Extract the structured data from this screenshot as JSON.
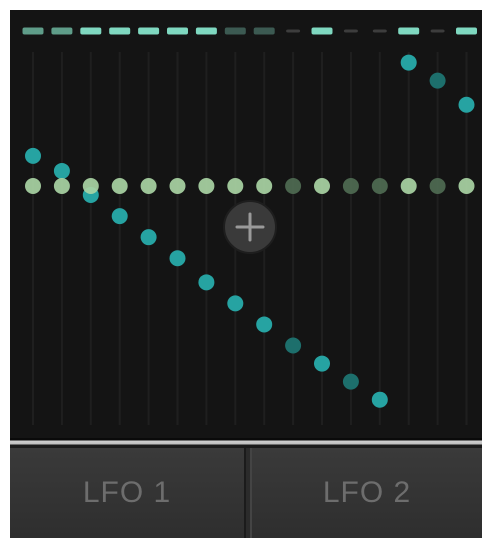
{
  "sequencer": {
    "step_count": 16,
    "colors": {
      "background": "#141414",
      "grid_line": "#1f1f1f",
      "indicator_bright": "#7fd8c0",
      "indicator_mid": "#5f9d89",
      "indicator_dim": "#3c5a52",
      "indicator_off": "#3d3d3d",
      "node_bright": "#a9d4a4",
      "node_dim": "#4f6b52",
      "node_teal": "#26a3a2",
      "node_teal_dim": "#1d6f6c"
    },
    "step_indicators": [
      "mid",
      "mid",
      "bright",
      "bright",
      "bright",
      "bright",
      "bright",
      "dim",
      "dim",
      "off",
      "bright",
      "off",
      "off",
      "bright",
      "off",
      "bright"
    ],
    "lanes": [
      {
        "name": "flat",
        "values": [
          0.5,
          0.5,
          0.5,
          0.5,
          0.5,
          0.5,
          0.5,
          0.5,
          0.5,
          0.5,
          0.5,
          0.5,
          0.5,
          0.5,
          0.5,
          0.5
        ],
        "states": [
          "bright",
          "bright",
          "bright",
          "bright",
          "bright",
          "bright",
          "bright",
          "bright",
          "bright",
          "dim",
          "bright",
          "dim",
          "dim",
          "bright",
          "dim",
          "bright"
        ]
      },
      {
        "name": "descending",
        "values": [
          0.6,
          0.55,
          0.47,
          0.4,
          0.33,
          0.26,
          0.18,
          0.11,
          0.04,
          -0.03,
          -0.09,
          -0.15,
          -0.21,
          0.91,
          0.85,
          0.77
        ],
        "states": [
          "teal",
          "teal",
          "teal",
          "teal",
          "teal",
          "teal",
          "teal",
          "teal",
          "teal",
          "teal_dim",
          "teal",
          "teal_dim",
          "teal",
          "teal",
          "teal_dim",
          "teal"
        ]
      }
    ],
    "add_button": {
      "icon": "plus-icon"
    }
  },
  "tabs": [
    {
      "label": "LFO 1"
    },
    {
      "label": "LFO 2"
    }
  ]
}
